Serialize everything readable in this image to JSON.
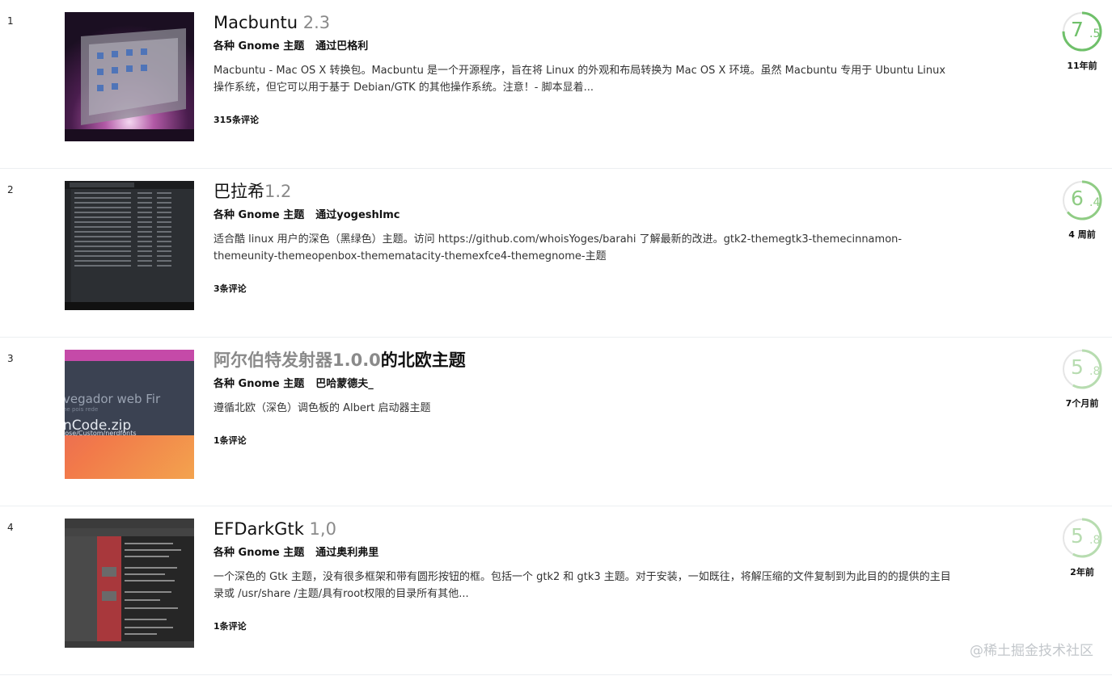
{
  "items": [
    {
      "rank": "1",
      "title": "Macbuntu",
      "version": " 2.3",
      "category": "各种 Gnome 主题",
      "author": "通过巴格利",
      "desc": "Macbuntu - Mac OS X 转换包。Macbuntu 是一个开源程序，旨在将 Linux 的外观和布局转换为 Mac OS X 环境。虽然 Macbuntu 专用于 Ubuntu Linux 操作系统，但它可以用于基于 Debian/GTK 的其他操作系统。注意！- 脚本显着...",
      "comments": "315条评论",
      "score_int": "7",
      "score_dec": ".5",
      "score_value": 7.5,
      "score_color": "#6fc06a",
      "age": "11年前"
    },
    {
      "rank": "2",
      "title": "巴拉希",
      "version": "1.2",
      "category": "各种 Gnome 主题",
      "author": "通过yogeshlmc",
      "desc": "适合酷 linux 用户的深色（黑绿色）主题。访问 https://github.com/whoisYoges/barahi 了解最新的改进。gtk2-themegtk3-themecinnamon-themeunity-themeopenbox-themematacity-themexfce4-themegnome-主题",
      "comments": "3条评论",
      "score_int": "6",
      "score_dec": ".4",
      "score_value": 6.4,
      "score_color": "#8fcc84",
      "age": "4 周前"
    },
    {
      "rank": "3",
      "title_gray": "阿尔伯特发射器1.0.0",
      "title": "的北欧主题",
      "category": "各种 Gnome 主题",
      "author": "巴哈蒙德夫_",
      "desc": "遵循北欧（深色）调色板的 Albert 启动器主题",
      "comments": "1条评论",
      "score_int": "5",
      "score_dec": ".8",
      "score_value": 5.8,
      "score_color": "#b7dcb0",
      "age": "7个月前"
    },
    {
      "rank": "4",
      "title": "EFDarkGtk",
      "version": " 1,0",
      "category": "各种 Gnome 主题",
      "author": "通过奥利弗里",
      "desc": "一个深色的 Gtk 主题，没有很多框架和带有圆形按钮的框。包括一个 gtk2 和 gtk3 主题。对于安装，一如既往，将解压缩的文件复制到为此目的的提供的主目录或 /usr/share /主题/具有root权限的目录所有其他...",
      "comments": "1条评论",
      "score_int": "5",
      "score_dec": ".8",
      "score_value": 5.8,
      "score_color": "#b7dcb0",
      "age": "2年前"
    }
  ],
  "thumb3_text": [
    "vegador web Fir",
    "ne pois rede",
    "nCode.zip",
    "jose/Custom/nerdfonts"
  ],
  "watermark": "@稀土掘金技术社区"
}
